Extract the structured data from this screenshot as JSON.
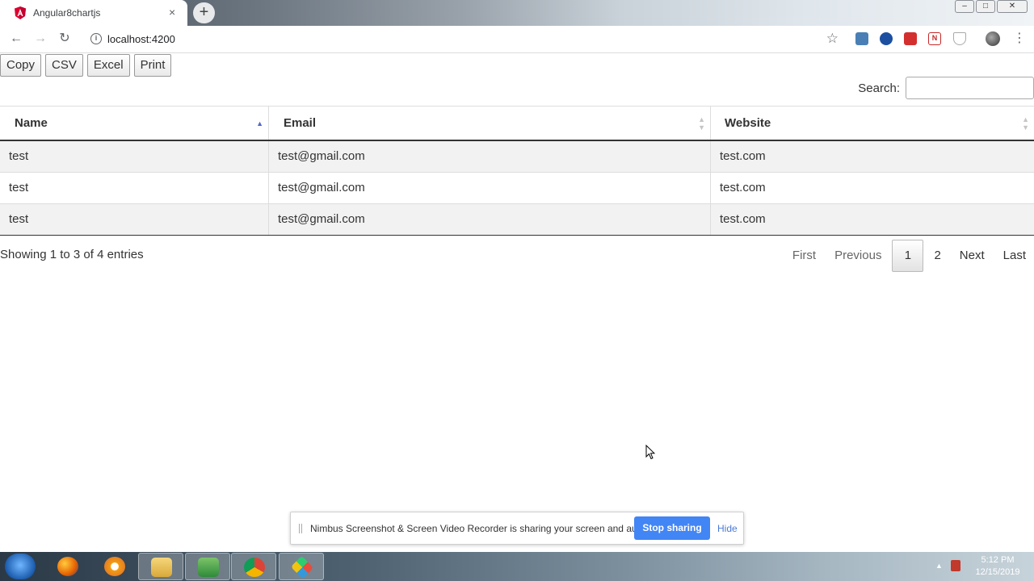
{
  "browser": {
    "tab_title": "Angular8chartjs",
    "tab_close": "×",
    "new_tab": "+",
    "url": "localhost:4200",
    "minimize": "–",
    "maximize": "□",
    "close": "✕"
  },
  "page": {
    "buttons": [
      "Copy",
      "CSV",
      "Excel",
      "Print"
    ],
    "search_label": "Search:",
    "search_value": "",
    "table": {
      "headers": [
        "Name",
        "Email",
        "Website"
      ],
      "sort_column": "Name",
      "sort_direction": "ascending",
      "rows": [
        [
          "test",
          "test@gmail.com",
          "test.com"
        ],
        [
          "test",
          "test@gmail.com",
          "test.com"
        ],
        [
          "test",
          "test@gmail.com",
          "test.com"
        ]
      ]
    },
    "info": "Showing 1 to 3 of 4 entries",
    "pagination": {
      "first": "First",
      "previous": "Previous",
      "pages": [
        "1",
        "2"
      ],
      "current": "1",
      "next": "Next",
      "last": "Last"
    }
  },
  "share_bar": {
    "message": "Nimbus Screenshot & Screen Video Recorder is sharing your screen and audio.",
    "stop_label": "Stop sharing",
    "hide_label": "Hide"
  },
  "taskbar": {
    "time": "5:12 PM",
    "date": "12/15/2019"
  },
  "colors": {
    "accent": "#4285f4",
    "sort_active": "#5467c9",
    "angular_red": "#dd0031",
    "row_stripe": "#f2f2f2"
  }
}
